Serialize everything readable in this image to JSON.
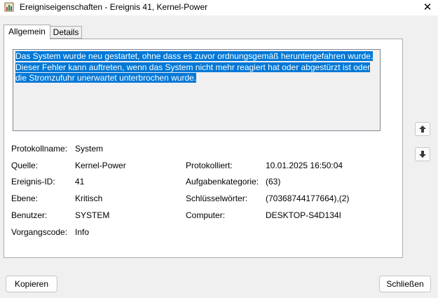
{
  "window": {
    "title": "Ereigniseigenschaften - Ereignis 41, Kernel-Power",
    "close_glyph": "✕"
  },
  "tabs": [
    {
      "label": "Allgemein",
      "selected": true
    },
    {
      "label": "Details",
      "selected": false
    }
  ],
  "description": "Das System wurde neu gestartet, ohne dass es zuvor ordnungsgemäß heruntergefahren wurde. Dieser Fehler kann auftreten, wenn das System nicht mehr reagiert hat oder abgestürzt ist oder die Stromzufuhr unerwartet unterbrochen wurde.",
  "fields": {
    "log_name": {
      "label": "Protokollname:",
      "value": "System"
    },
    "source": {
      "label": "Quelle:",
      "value": "Kernel-Power"
    },
    "logged": {
      "label": "Protokolliert:",
      "value": "10.01.2025 16:50:04"
    },
    "event_id": {
      "label": "Ereignis-ID:",
      "value": "41"
    },
    "task_category": {
      "label": "Aufgabenkategorie:",
      "value": "(63)"
    },
    "level": {
      "label": "Ebene:",
      "value": "Kritisch"
    },
    "keywords": {
      "label": "Schlüsselwörter:",
      "value": "(70368744177664),(2)"
    },
    "user": {
      "label": "Benutzer:",
      "value": "SYSTEM"
    },
    "computer": {
      "label": "Computer:",
      "value": "DESKTOP-S4D134I"
    },
    "opcode": {
      "label": "Vorgangscode:",
      "value": "Info"
    }
  },
  "buttons": {
    "copy": "Kopieren",
    "close": "Schließen"
  },
  "icons": {
    "app": "event-viewer-icon",
    "up": "arrow-up-icon",
    "down": "arrow-down-icon"
  },
  "colors": {
    "selection": "#0078d7",
    "background": "#f0f0f0"
  }
}
